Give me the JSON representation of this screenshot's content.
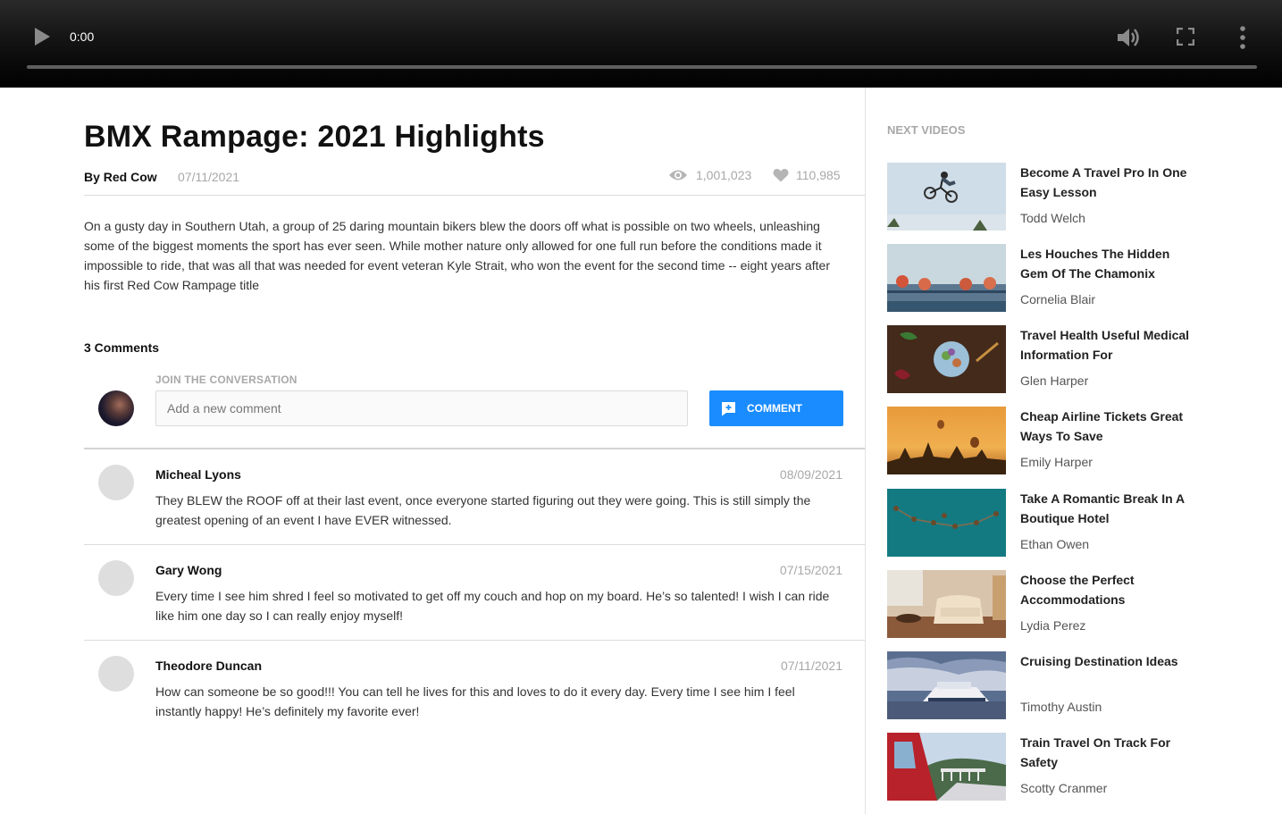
{
  "player": {
    "time": "0:00",
    "progress": 0
  },
  "video": {
    "title": "BMX Rampage: 2021 Highlights",
    "author": "By Red Cow",
    "date": "07/11/2021",
    "views": "1,001,023",
    "likes": "110,985",
    "description": "On a gusty day in Southern Utah, a group of 25 daring mountain bikers blew the doors off what is possible on two wheels, unleashing some of the biggest moments the sport has ever seen. While mother nature only allowed for one full run before the conditions made it impossible to ride, that was all that was needed for event veteran Kyle Strait, who won the event for the second time -- eight years after his first Red Cow Rampage title"
  },
  "comments_section": {
    "count_label": "3 Comments",
    "join_label": "JOIN THE CONVERSATION",
    "input_placeholder": "Add a new comment",
    "button_label": "COMMENT",
    "accent_color": "#1a8cff",
    "items": [
      {
        "name": "Micheal Lyons",
        "date": "08/09/2021",
        "text": "They BLEW the ROOF off at their last event, once everyone started figuring out they were going. This is still simply the greatest opening of an event I have EVER witnessed."
      },
      {
        "name": "Gary Wong",
        "date": "07/15/2021",
        "text": "Every time I see him shred I feel so motivated to get off my couch and hop on my board. He’s so talented! I wish I can ride like him one day so I can really enjoy myself!"
      },
      {
        "name": "Theodore Duncan",
        "date": "07/11/2021",
        "text": "How can someone be so good!!! You can tell he lives for this and loves to do it every day. Every time I see him I feel instantly happy! He’s definitely my favorite ever!"
      }
    ]
  },
  "sidebar": {
    "heading": "NEXT VIDEOS",
    "videos": [
      {
        "title": "Become A Travel Pro In One Easy Lesson",
        "author": "Todd Welch"
      },
      {
        "title": "Les Houches The Hidden Gem Of The Chamonix",
        "author": "Cornelia Blair"
      },
      {
        "title": "Travel Health Useful Medical Information For",
        "author": "Glen Harper"
      },
      {
        "title": "Cheap Airline Tickets Great Ways To Save",
        "author": "Emily Harper"
      },
      {
        "title": "Take A Romantic Break In A Boutique Hotel",
        "author": "Ethan Owen"
      },
      {
        "title": "Choose the Perfect Accommodations",
        "author": "Lydia Perez"
      },
      {
        "title": "Cruising Destination Ideas",
        "author": "Timothy Austin"
      },
      {
        "title": "Train Travel On Track For Safety",
        "author": "Scotty Cranmer"
      }
    ]
  }
}
